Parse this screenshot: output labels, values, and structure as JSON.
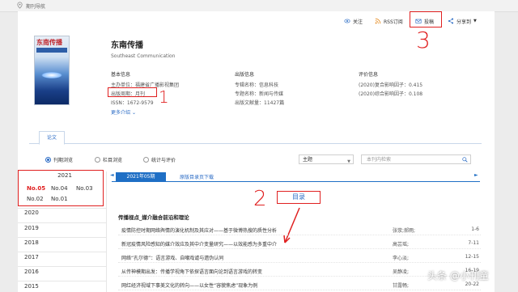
{
  "breadcrumb": {
    "label": "期刊导航"
  },
  "actions": {
    "follow": "关注",
    "rss": "RSS订阅",
    "submit": "投稿",
    "share": "分享到"
  },
  "journal": {
    "title": "东南传播",
    "subtitle": "Southeast Communication",
    "cover_title": "东南传播"
  },
  "basic_info": {
    "heading": "基本信息",
    "sponsor": "主办单位：福建省广播影视集团",
    "cycle": "出版周期：月刊",
    "issn": "ISSN：1672-9579",
    "more": "更多介绍"
  },
  "publish_info": {
    "heading": "出版信息",
    "subject": "专辑名称：信息科技",
    "topic": "专题名称：新闻与传媒",
    "count": "出版文献量：11427篇"
  },
  "eval_info": {
    "heading": "评价信息",
    "factor1": "(2020)复合影响因子：0.415",
    "factor2": "(2020)综合影响因子：0.108"
  },
  "tab": {
    "label": "论文"
  },
  "browse": {
    "by_issue": "刊期浏览",
    "by_column": "栏目浏览",
    "by_stats": "统计与评价",
    "select": "主题",
    "search_placeholder": "本刊内检索"
  },
  "year_panel": {
    "current_year": "2021",
    "issues": [
      "No.05",
      "No.04",
      "No.03",
      "No.02",
      "No.01"
    ],
    "selected_issue": "No.05",
    "years": [
      "2020",
      "2019",
      "2018",
      "2017",
      "2016",
      "2015"
    ]
  },
  "issue_view": {
    "nav_prev": "◄",
    "nav_next": "►",
    "issue_tab": "2021年05期",
    "download": "原版目录页下载",
    "toc_label": "目录",
    "column": "传播视点_媒介融合前沿和理论",
    "articles": [
      {
        "title": "疫情防控时期网络舆情的演化机制及其应对——基于微博热搜的质性分析",
        "author": "张荥;郝雨;",
        "pages": "1-6"
      },
      {
        "title": "新冠疫情风险感知的媒介效应及其中介变量研究——以效能感为多重中介",
        "author": "高芸瑶;",
        "pages": "7-11"
      },
      {
        "title": "网络“孔尔德”：语言游戏、自嘲戏谑与遗伪认同",
        "author": "李心淡;",
        "pages": "12-15"
      },
      {
        "title": "从传神模期出发：传播学视角下依探语言面向论到语言游戏的转变",
        "author": "吴静凌;",
        "pages": "16-19"
      },
      {
        "title": "网红经济视域下事美文化的转向——以女性“容貌焦虑”现象为例",
        "author": "甘露畅;",
        "pages": "20-22"
      }
    ]
  },
  "annotations": {
    "one": "1",
    "two": "2",
    "three": "3"
  },
  "watermark": {
    "text": "头条 @小刊童"
  }
}
